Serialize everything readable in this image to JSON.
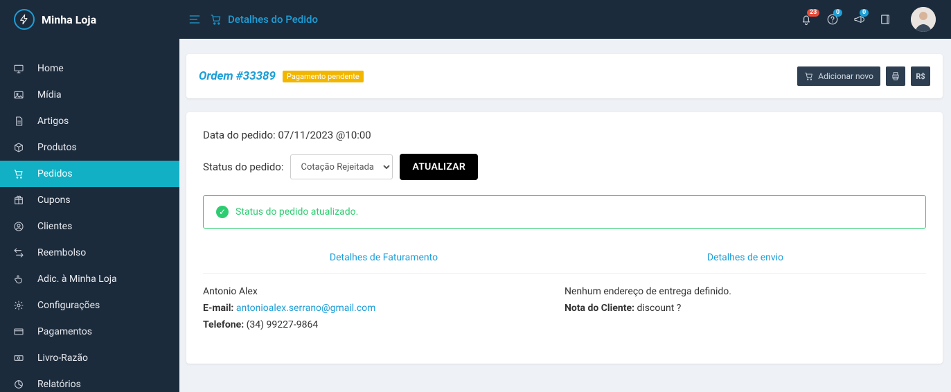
{
  "brand": {
    "title": "Minha Loja"
  },
  "header": {
    "page_title": "Detalhes do Pedido",
    "notifications_badge": "23",
    "help_badge": "0",
    "announce_badge": "0"
  },
  "sidebar": {
    "items": [
      {
        "label": "Home"
      },
      {
        "label": "Mídia"
      },
      {
        "label": "Artigos"
      },
      {
        "label": "Produtos"
      },
      {
        "label": "Pedidos"
      },
      {
        "label": "Cupons"
      },
      {
        "label": "Clientes"
      },
      {
        "label": "Reembolso"
      },
      {
        "label": "Adic. à Minha Loja"
      },
      {
        "label": "Configurações"
      },
      {
        "label": "Pagamentos"
      },
      {
        "label": "Livro-Razão"
      },
      {
        "label": "Relatórios"
      }
    ],
    "active_index": 4
  },
  "order_header": {
    "title": "Ordem #33389",
    "status_chip": "Pagamento pendente",
    "add_new_label": "Adicionar novo",
    "currency_icon_label": "R$"
  },
  "order": {
    "date_label": "Data do pedido: 07/11/2023 @10:00",
    "status_label": "Status do pedido:",
    "status_value": "Cotação Rejeitada",
    "update_button": "ATUALIZAR",
    "alert": "Status do pedido atualizado."
  },
  "billing": {
    "heading": "Detalhes de Faturamento",
    "name": "Antonio Alex",
    "email_label": "E-mail:",
    "email": "antonioalex.serrano@gmail.com",
    "phone_label": "Telefone:",
    "phone": "(34) 99227-9864"
  },
  "shipping": {
    "heading": "Detalhes de envio",
    "no_address": "Nenhum endereço de entrega definido.",
    "note_label": "Nota do Cliente:",
    "note_value": "discount ?"
  }
}
